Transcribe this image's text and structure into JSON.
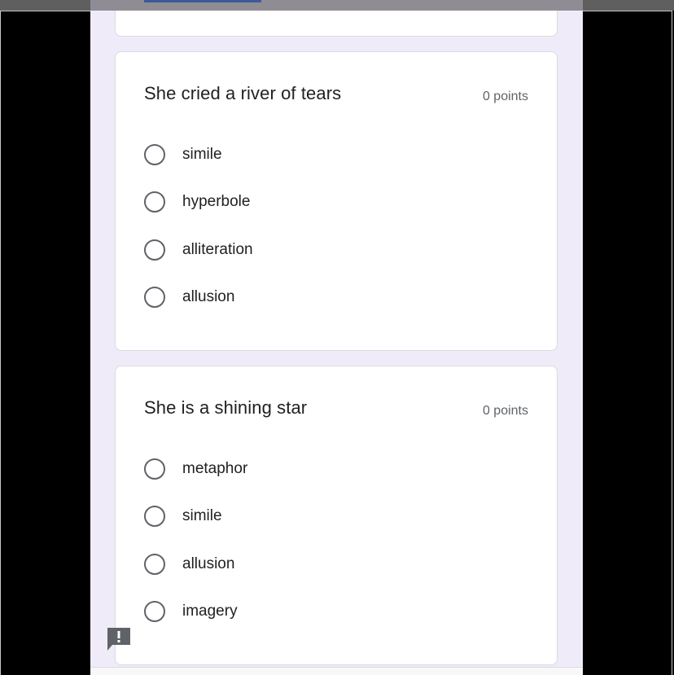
{
  "questions": [
    {
      "title": "She cried a river of tears",
      "points": "0 points",
      "options": [
        "simile",
        "hyperbole",
        "alliteration",
        "allusion"
      ]
    },
    {
      "title": "She is a shining star",
      "points": "0 points",
      "options": [
        "metaphor",
        "simile",
        "allusion",
        "imagery"
      ]
    }
  ],
  "colors": {
    "page_background": "#f0ebf8",
    "card_background": "#ffffff",
    "radio_border": "#5f6368",
    "text": "#202124",
    "link": "#3c5a9a"
  },
  "icons": {
    "feedback": "report-feedback-icon"
  }
}
